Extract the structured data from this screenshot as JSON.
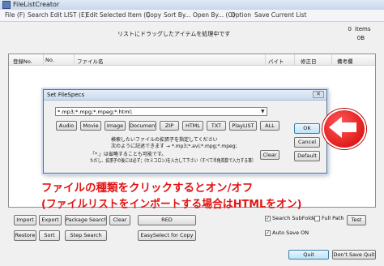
{
  "window": {
    "title": "FileListCreator"
  },
  "menu": [
    "File (F)",
    "Search",
    "Edit LIST (E)",
    "Edit Selected Item (I)",
    "Copy",
    "Sort By...",
    "Open By... (O)",
    "Option",
    "Save Current List"
  ],
  "status": {
    "message": "リストにドラッグしたアイテムを処理中です",
    "items_count": "0",
    "items_label": "items",
    "size": "0B"
  },
  "list_columns": [
    "登録No.",
    "No.",
    "ファイル名",
    "バイト",
    "修正日",
    "備考欄"
  ],
  "dialog": {
    "title": "Set FileSpecs",
    "close_icon": "close-icon",
    "filter_value": "*.mp3;*.mpg;*.mpeg;*.html;",
    "type_buttons": [
      "Audio",
      "Movie",
      "Image",
      "Document",
      "ZIP",
      "HTML",
      "TXT",
      "PlayLIST",
      "ALL"
    ],
    "ok_label": "OK",
    "cancel_label": "Cancel",
    "default_label": "Default",
    "clear_label": "Clear",
    "hint_line1": "検索したいファイルの拡張子を指定してください",
    "hint_line2": "次のように記述できます → *.mp3;*.avi;*.mpg;*.mpeg;",
    "hint_line3": "「*.」は省略することも可能です。",
    "hint_line4": "ただし、拡張子の後には必ず；(セミコロン)を入力して下さい（すべて半角英数で入力する事）"
  },
  "annotation": {
    "line1": "ファイルの種類をクリックするとオン/オフ",
    "line2": "(ファイルリストをインポートする場合はHTMLをオン)",
    "color": "#e11515"
  },
  "bottom": {
    "buttons_row1": [
      "Import",
      "Export",
      "Package Search",
      "Clear"
    ],
    "buttons_row2": [
      "Restore",
      "Sort",
      "Step Search"
    ],
    "red_label": "RED",
    "easy_select_label": "EasySelect for Copy",
    "search_subfolder": {
      "label": "Search SubFolder",
      "checked": true
    },
    "full_path": {
      "label": "Full Path",
      "checked": false
    },
    "auto_save": {
      "label": "Auto Save ON",
      "checked": true
    },
    "test_label": "Test",
    "quit_label": "Quit",
    "dont_save_quit_label": "Don't Save Quit"
  }
}
